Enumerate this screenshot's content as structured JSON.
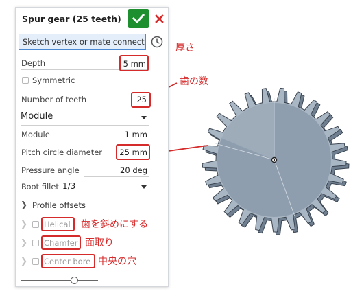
{
  "dialog": {
    "title": "Spur gear (25 teeth)",
    "vertex_placeholder": "Sketch vertex or mate connector",
    "depth": {
      "label": "Depth",
      "value": "5 mm"
    },
    "symmetric": {
      "label": "Symmetric",
      "checked": false
    },
    "teeth": {
      "label": "Number of teeth",
      "value": "25"
    },
    "gear_type": "Module",
    "module": {
      "label": "Module",
      "value": "1 mm"
    },
    "pitch": {
      "label": "Pitch circle diameter",
      "value": "25 mm"
    },
    "pressure": {
      "label": "Pressure angle",
      "value": "20 deg"
    },
    "root_fillet": {
      "label": "Root fillet",
      "value": "1/3"
    },
    "profile_offsets": "Profile offsets",
    "helical": "Helical",
    "chamfer": "Chamfer",
    "center_bore": "Center bore"
  },
  "annotations": {
    "thickness": "厚さ",
    "teeth_count": "歯の数",
    "helical": "歯を斜めにする",
    "chamfer": "面取り",
    "center_bore": "中央の穴"
  },
  "colors": {
    "accept_green": "#1e8f2f",
    "cancel_red": "#d62b2b",
    "annotation_red": "#d62b2b",
    "focus_blue": "#4b8ad3",
    "gear_face": "#8e9eae"
  },
  "icons": [
    "check-icon",
    "close-icon",
    "clock-icon",
    "chevron-right-icon",
    "caret-down-icon",
    "gear-3d-model"
  ]
}
